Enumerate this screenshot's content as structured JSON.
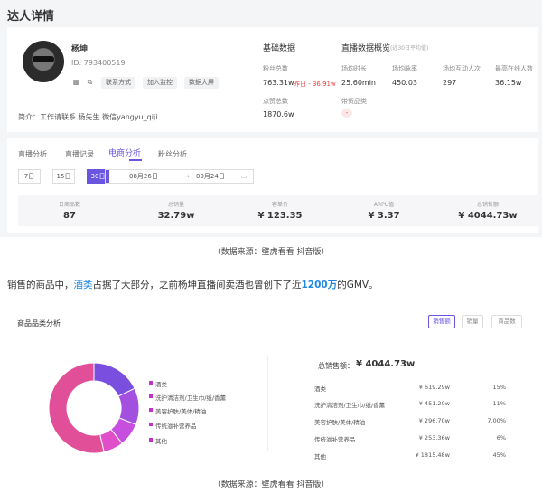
{
  "profile": {
    "page_title": "达人详情",
    "name": "杨坤",
    "id": "ID: 793400519",
    "contact_btn": "联系方式",
    "monitor_btn": "加入监控",
    "bigscreen_btn": "数据大屏",
    "intro": "简介：工作请联系 杨先生 微信yangyu_qiji"
  },
  "basic": {
    "title": "基础数据",
    "fans_label": "粉丝总数",
    "fans_value": "763.31w",
    "fans_yesterday": "昨日 - 36.91w",
    "likes_label": "点赞总数",
    "likes_value": "1870.6w"
  },
  "live_overview": {
    "title": "直播数据概览",
    "subtitle": "(近30日平均值)",
    "duration_label": "场均时长",
    "duration_value": "25.60min",
    "pv_label": "场均脉率",
    "pv_value": "450.03",
    "interact_label": "场均互动人次",
    "interact_value": "297",
    "peak_label": "最高在线人数",
    "peak_value": "36.15w",
    "goods_label": "带货品类",
    "goods_value": "-"
  },
  "tabs": {
    "live": "直播分析",
    "records": "直播记录",
    "ecommerce": "电商分析",
    "fans": "粉丝分析"
  },
  "range": {
    "d7": "7日",
    "d15": "15日",
    "d30": "30日",
    "start": "08月26日",
    "arrow": "→",
    "end": "09月24日"
  },
  "stats": [
    {
      "label": "日商品数",
      "value": "87"
    },
    {
      "label": "总销量",
      "value": "32.79w"
    },
    {
      "label": "客单价",
      "value": "¥ 123.35"
    },
    {
      "label": "ARPU值",
      "value": "¥ 3.37"
    },
    {
      "label": "总销售额",
      "value": "¥ 4044.73w"
    }
  ],
  "caption1": "（数据来源：壁虎看看 抖音版）",
  "para": {
    "a": "销售的商品中，",
    "b": "酒类",
    "c": "占据了大部分，之前杨坤直播间卖酒也曾创下了近",
    "d": "1200万",
    "e": "的GMV。"
  },
  "category": {
    "title": "商品品类分析",
    "btn_sales_amount": "销售额",
    "btn_sales_count": "销量",
    "btn_goods_count": "商品数",
    "legend": [
      "酒类",
      "洗护清洁剂/卫生巾/纸/香薰",
      "美容护肤/美体/精油",
      "传统滋补营养品",
      "其他"
    ],
    "total_label": "总销售额：",
    "total_value": "¥ 4044.73w",
    "rows": [
      {
        "name": "酒类",
        "amount": "¥ 619.29w",
        "pct": "15%"
      },
      {
        "name": "洗护清洁剂/卫生巾/纸/香薰",
        "amount": "¥ 451.20w",
        "pct": "11%"
      },
      {
        "name": "美容护肤/美体/精油",
        "amount": "¥ 296.70w",
        "pct": "7.00%"
      },
      {
        "name": "传统滋补营养品",
        "amount": "¥ 253.36w",
        "pct": "6%"
      },
      {
        "name": "其他",
        "amount": "¥ 1815.48w",
        "pct": "45%"
      }
    ]
  },
  "chart_data": {
    "type": "pie",
    "categories": [
      "酒类",
      "洗护清洁剂/卫生巾/纸/香薰",
      "美容护肤/美体/精油",
      "传统滋补营养品",
      "其他"
    ],
    "values": [
      15,
      11,
      7,
      6,
      45
    ],
    "colors": [
      "#7a4fe0",
      "#a34fe0",
      "#c64fe0",
      "#e04fc9",
      "#e04f98"
    ]
  },
  "caption2": "（数据来源：壁虎看看 抖音版）"
}
